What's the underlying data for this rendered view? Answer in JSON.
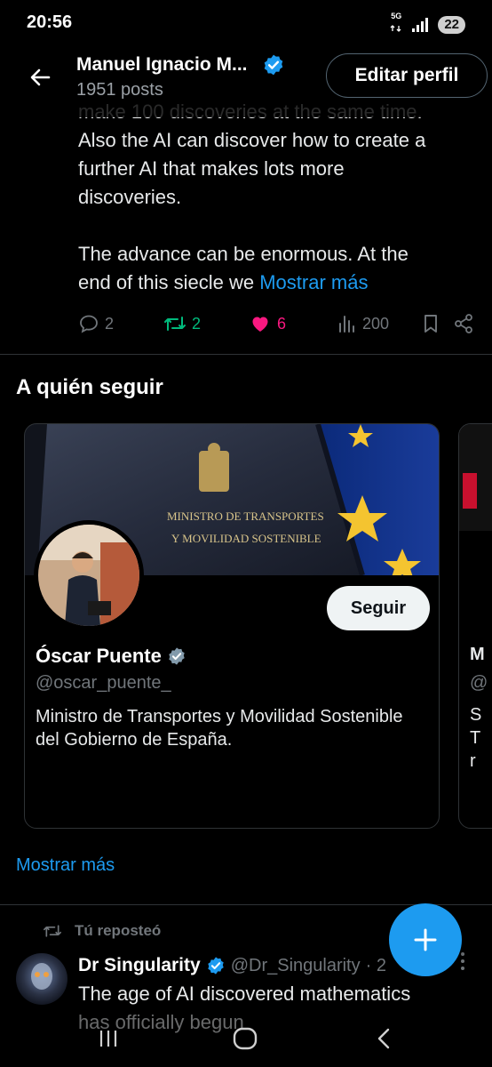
{
  "status_bar": {
    "time": "20:56",
    "network": "5G",
    "battery": "22"
  },
  "header": {
    "name": "Manuel Ignacio M...",
    "posts": "1951 posts",
    "edit_profile_label": "Editar perfil"
  },
  "tweet": {
    "lines": [
      "make 100 discoveries at the same time.",
      "Also the AI can discover how to create a",
      "further AI that makes lots more",
      "discoveries."
    ],
    "paragraph2_prefix": "The advance can be enormous. At the",
    "paragraph2_line2": "end of this siecle we ",
    "show_more_inline": "Mostrar más",
    "replies": "2",
    "retweets": "2",
    "likes": "6",
    "views": "200"
  },
  "who_to_follow": {
    "title": "A quién seguir",
    "card": {
      "banner_text_line1": "MINISTRO DE TRANSPORTES",
      "banner_text_line2": "Y MOVILIDAD SOSTENIBLE",
      "name": "Óscar Puente",
      "handle": "@oscar_puente_",
      "bio": "Ministro de Transportes y Movilidad Sostenible del Gobierno de España.",
      "follow_label": "Seguir"
    },
    "peek_card": {
      "letters": [
        "M",
        "@",
        "S",
        "T",
        "r"
      ]
    },
    "show_more": "Mostrar más"
  },
  "repost": {
    "label": "Tú reposteó",
    "name": "Dr Singularity",
    "handle": "@Dr_Singularity",
    "separator": "· 2",
    "text_line1": "The age of AI discovered mathematics",
    "text_line2": "has officially begun"
  },
  "colors": {
    "accent": "#1d9bf0",
    "retweet": "#00ba7c",
    "like": "#f91880",
    "muted": "#71767b"
  }
}
